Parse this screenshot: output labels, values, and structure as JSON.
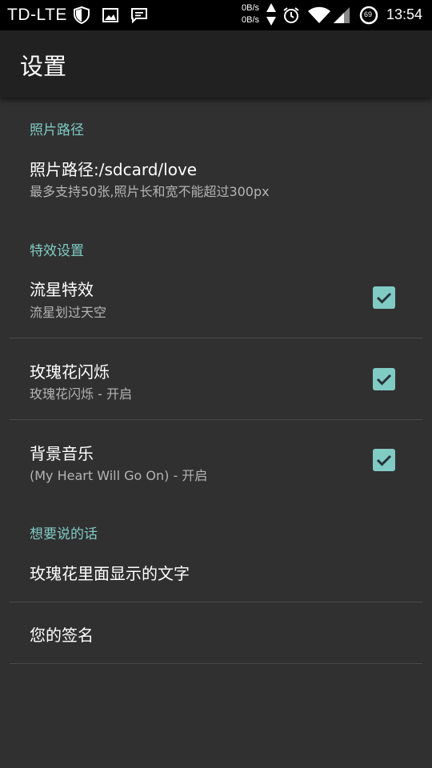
{
  "status_bar": {
    "carrier": "TD-LTE",
    "speed_up": "0B/s",
    "speed_down": "0B/s",
    "battery_level": "69",
    "time": "13:54",
    "icons": [
      "shield-icon",
      "image-icon",
      "message-icon",
      "upload-arrow-icon",
      "download-arrow-icon",
      "alarm-icon",
      "wifi-icon",
      "signal-icon",
      "battery-icon"
    ]
  },
  "app_bar": {
    "title": "设置"
  },
  "sections": {
    "photo": {
      "header": "照片路径",
      "path_title": "照片路径:/sdcard/love",
      "path_summary": "最多支持50张,照片长和宽不能超过300px"
    },
    "effects": {
      "header": "特效设置",
      "meteor_title": "流星特效",
      "meteor_summary": "流星划过天空",
      "meteor_checked": true,
      "rose_title": "玫瑰花闪烁",
      "rose_summary": "玫瑰花闪烁 - 开启",
      "rose_checked": true,
      "music_title": "背景音乐",
      "music_summary": "(My Heart Will Go On) - 开启",
      "music_checked": true
    },
    "words": {
      "header": "想要说的话",
      "rose_text_title": "玫瑰花里面显示的文字",
      "signature_title": "您的签名"
    }
  },
  "colors": {
    "accent": "#80cbc4",
    "background": "#303030",
    "app_bar": "#212121",
    "status_bar": "#000000"
  }
}
